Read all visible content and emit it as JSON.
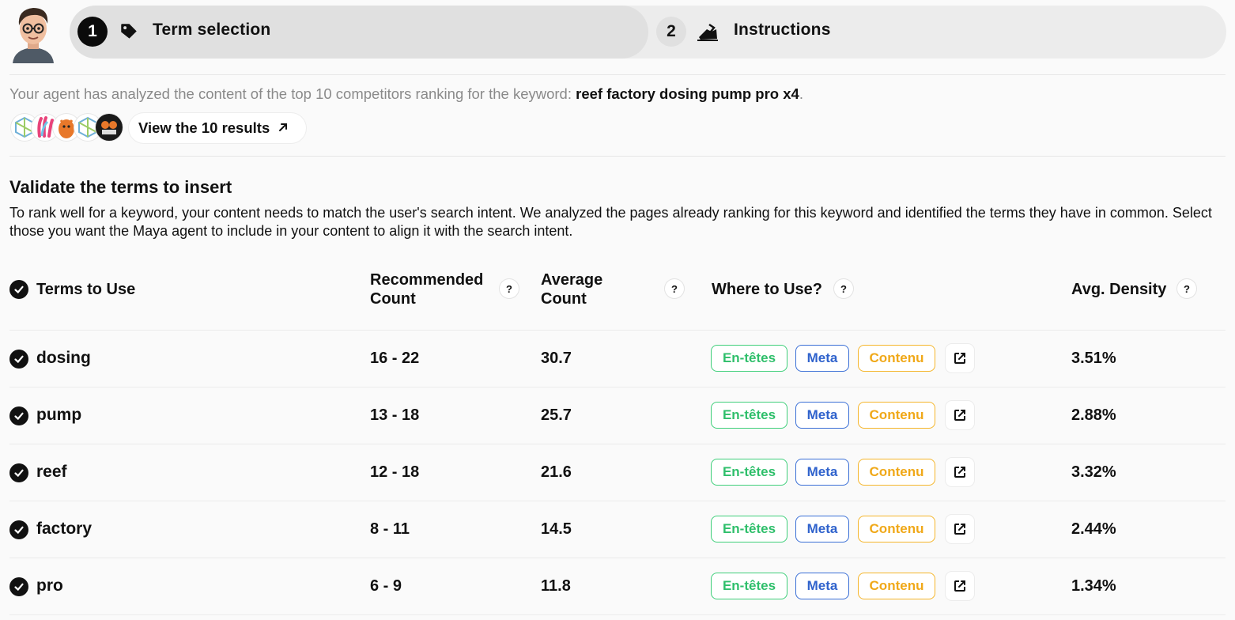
{
  "stepper": {
    "steps": [
      {
        "number": "1",
        "label": "Term selection",
        "icon": "tag-icon",
        "active": true
      },
      {
        "number": "2",
        "label": "Instructions",
        "icon": "writing-hand-icon",
        "active": false
      }
    ]
  },
  "intro": {
    "text": "Your agent has analyzed the content of the top 10 competitors ranking for the keyword: ",
    "keyword": "reef factory dosing pump pro x4",
    "suffix": "."
  },
  "results_button": {
    "label": "View the 10 results",
    "icon": "arrow-up-right-icon"
  },
  "section": {
    "title": "Validate the terms to insert",
    "description": "To rank well for a keyword, your content needs to match the user's search intent. We analyzed the pages already ranking for this keyword and identified the terms they have in common. Select those you want the Maya agent to include in your content to align it with the search intent."
  },
  "table": {
    "headers": {
      "terms": "Terms to Use",
      "recommended_line1": "Recommended",
      "recommended_line2": "Count",
      "average_line1": "Average",
      "average_line2": "Count",
      "where": "Where to Use?",
      "density": "Avg. Density",
      "help": "?"
    },
    "tags": {
      "headings": "En-têtes",
      "meta": "Meta",
      "content": "Contenu"
    },
    "rows": [
      {
        "term": "dosing",
        "recommended": "16 - 22",
        "average": "30.7",
        "density": "3.51%"
      },
      {
        "term": "pump",
        "recommended": "13 - 18",
        "average": "25.7",
        "density": "2.88%"
      },
      {
        "term": "reef",
        "recommended": "12 - 18",
        "average": "21.6",
        "density": "3.32%"
      },
      {
        "term": "factory",
        "recommended": "8 - 11",
        "average": "14.5",
        "density": "2.44%"
      },
      {
        "term": "pro",
        "recommended": "6 - 9",
        "average": "11.8",
        "density": "1.34%"
      }
    ]
  },
  "colors": {
    "headings_tag": "#3fcf7a",
    "meta_tag": "#3a6fd6",
    "content_tag": "#f5b52a"
  }
}
